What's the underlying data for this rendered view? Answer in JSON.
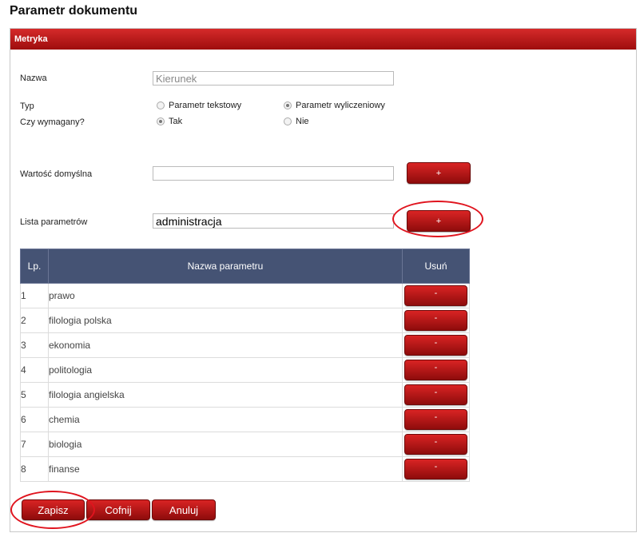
{
  "page": {
    "title": "Parametr dokumentu"
  },
  "panel": {
    "header": "Metryka"
  },
  "form": {
    "name_label": "Nazwa",
    "name_value": "Kierunek",
    "type_label": "Typ",
    "type_option_text": "Parametr tekstowy",
    "type_option_calc": "Parametr wyliczeniowy",
    "type_selected": "Parametr wyliczeniowy",
    "required_label": "Czy wymagany?",
    "required_yes": "Tak",
    "required_no": "Nie",
    "required_selected": "Tak",
    "default_label": "Wartość domyślna",
    "default_value": "",
    "default_add": "+",
    "params_label": "Lista parametrów",
    "params_value": "administracja",
    "params_add": "+"
  },
  "table": {
    "headers": {
      "lp": "Lp.",
      "name": "Nazwa parametru",
      "remove": "Usuń"
    },
    "remove_label": "-",
    "rows": [
      {
        "lp": "1",
        "name": "prawo"
      },
      {
        "lp": "2",
        "name": "filologia polska"
      },
      {
        "lp": "3",
        "name": "ekonomia"
      },
      {
        "lp": "4",
        "name": "politologia"
      },
      {
        "lp": "5",
        "name": "filologia angielska"
      },
      {
        "lp": "6",
        "name": "chemia"
      },
      {
        "lp": "7",
        "name": "biologia"
      },
      {
        "lp": "8",
        "name": "finanse"
      }
    ]
  },
  "actions": {
    "save": "Zapisz",
    "back": "Cofnij",
    "cancel": "Anuluj"
  },
  "colors": {
    "accent_red": "#b31313",
    "table_header": "#455374",
    "highlight": "#e0141e"
  }
}
